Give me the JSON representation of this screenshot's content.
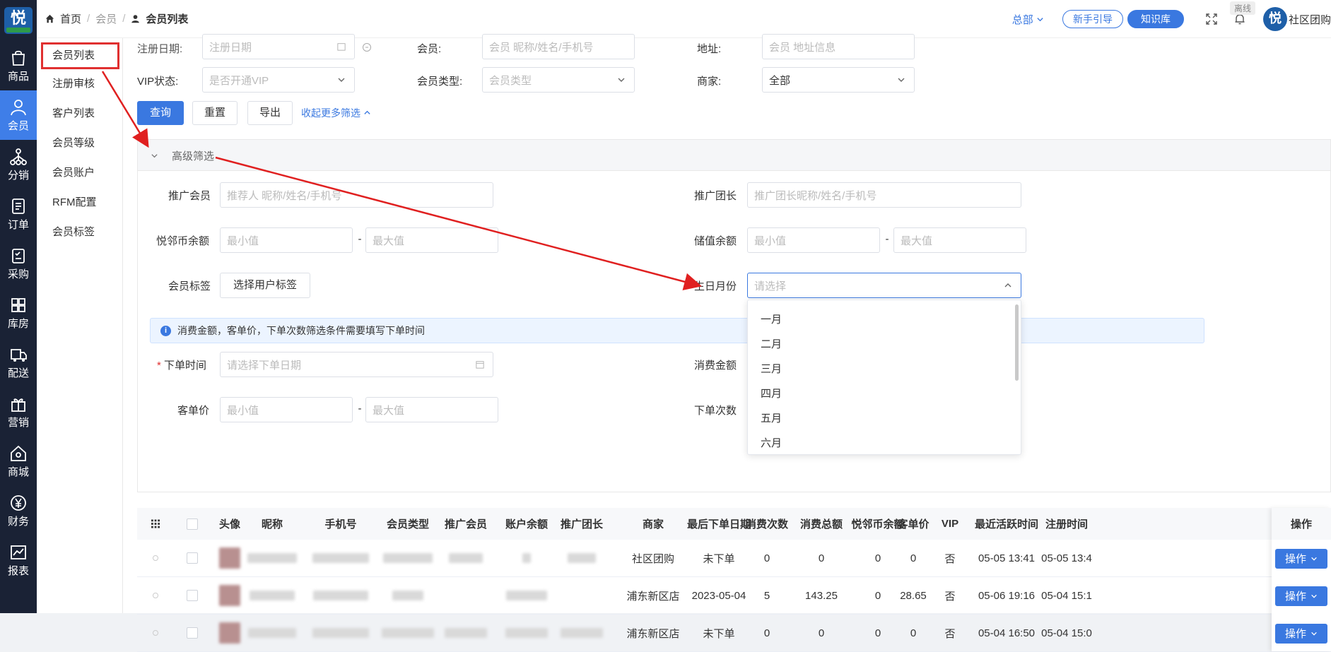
{
  "brand": {
    "logo_glyph": "悦",
    "accent": "#3a78e0",
    "rail_bg": "#1a2235"
  },
  "rail": [
    {
      "label": "商品",
      "icon": "bag-icon"
    },
    {
      "label": "会员",
      "icon": "person-icon",
      "active": true
    },
    {
      "label": "分销",
      "icon": "network-icon"
    },
    {
      "label": "订单",
      "icon": "document-icon"
    },
    {
      "label": "采购",
      "icon": "clipboard-icon"
    },
    {
      "label": "库房",
      "icon": "grid-icon"
    },
    {
      "label": "配送",
      "icon": "truck-icon"
    },
    {
      "label": "营销",
      "icon": "gift-icon"
    },
    {
      "label": "商城",
      "icon": "home-icon"
    },
    {
      "label": "财务",
      "icon": "yen-icon"
    },
    {
      "label": "报表",
      "icon": "chart-icon"
    }
  ],
  "subnav": [
    {
      "label": "会员列表",
      "active": true
    },
    {
      "label": "注册审核"
    },
    {
      "label": "客户列表"
    },
    {
      "label": "会员等级"
    },
    {
      "label": "会员账户"
    },
    {
      "label": "RFM配置"
    },
    {
      "label": "会员标签"
    }
  ],
  "breadcrumb": {
    "home": "首页",
    "section": "会员",
    "current": "会员列表"
  },
  "topbar": {
    "org": "总部",
    "guide": "新手引导",
    "kb": "知识库",
    "offline": "离线",
    "avatar": "悦",
    "user": "社区团购"
  },
  "filters": {
    "reg_date_label": "注册日期:",
    "reg_date_placeholder": "注册日期",
    "member_label": "会员:",
    "member_placeholder": "会员 昵称/姓名/手机号",
    "address_label": "地址:",
    "address_placeholder": "会员 地址信息",
    "vip_label": "VIP状态:",
    "vip_placeholder": "是否开通VIP",
    "type_label": "会员类型:",
    "type_placeholder": "会员类型",
    "merchant_label": "商家:",
    "merchant_value": "全部",
    "query": "查询",
    "reset": "重置",
    "export": "导出",
    "collapse": "收起更多筛选"
  },
  "advanced": {
    "title": "高级筛选",
    "promoter_label": "推广会员",
    "promoter_placeholder": "推荐人 昵称/姓名/手机号",
    "leader_label": "推广团长",
    "leader_placeholder": "推广团长昵称/姓名/手机号",
    "coin_label": "悦邻币余额",
    "min": "最小值",
    "max": "最大值",
    "dash": "-",
    "stored_label": "储值余额",
    "tag_label": "会员标签",
    "tag_button": "选择用户标签",
    "birth_label": "生日月份",
    "birth_placeholder": "请选择",
    "notice": "消费金额，客单价，下单次数筛选条件需要填写下单时间",
    "order_time_label": "下单时间",
    "required_mark": "*",
    "order_time_placeholder": "请选择下单日期",
    "spend_label": "消费金额",
    "avg_label": "客单价",
    "count_label": "下单次数"
  },
  "months": [
    "一月",
    "二月",
    "三月",
    "四月",
    "五月",
    "六月"
  ],
  "table": {
    "headers": {
      "avatar": "头像",
      "nick": "昵称",
      "phone": "手机号",
      "type": "会员类型",
      "promoter": "推广会员",
      "balance": "账户余额",
      "leader": "推广团长",
      "merchant": "商家",
      "last_order": "最后下单日期",
      "count": "消费次数",
      "total": "消费总额",
      "coin": "悦邻币余额",
      "avg": "客单价",
      "vip": "VIP",
      "active": "最近活跃时间",
      "reg": "注册时间",
      "op": "操作"
    },
    "op_button": "操作",
    "rows": [
      {
        "merchant": "社区团购",
        "last_order": "未下单",
        "count": "0",
        "total": "0",
        "coin": "0",
        "avg": "0",
        "vip": "否",
        "active": "05-05 13:41",
        "reg": "05-05 13:4"
      },
      {
        "merchant": "浦东新区店",
        "last_order": "2023-05-04",
        "count": "5",
        "total": "143.25",
        "coin": "0",
        "avg": "28.65",
        "vip": "否",
        "active": "05-06 19:16",
        "reg": "05-04 15:1"
      },
      {
        "merchant": "浦东新区店",
        "last_order": "未下单",
        "count": "0",
        "total": "0",
        "coin": "0",
        "avg": "0",
        "vip": "否",
        "active": "05-04 16:50",
        "reg": "05-04 15:0"
      }
    ]
  }
}
